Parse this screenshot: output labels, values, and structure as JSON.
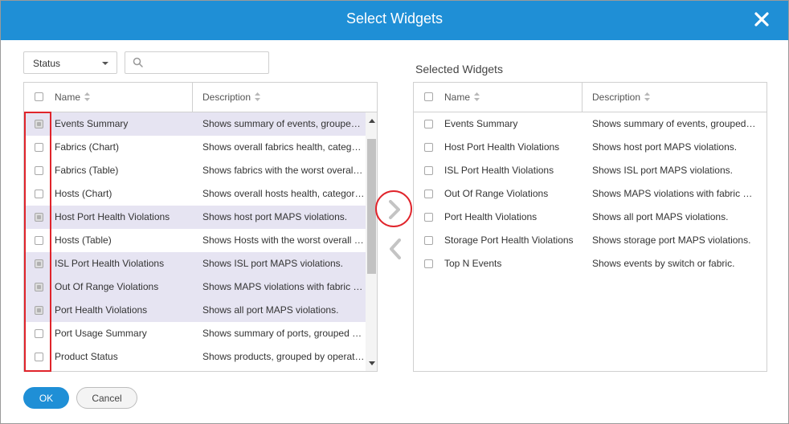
{
  "dialog": {
    "title": "Select Widgets",
    "close_icon": "close-icon"
  },
  "filter": {
    "selected": "Status",
    "search_value": "",
    "search_placeholder": ""
  },
  "available": {
    "columns": {
      "name": "Name",
      "description": "Description"
    },
    "rows": [
      {
        "name": "Events Summary",
        "description": "Shows summary of events, grouped by severity.",
        "checked": true
      },
      {
        "name": "Fabrics (Chart)",
        "description": "Shows overall fabrics health, categorized by status.",
        "checked": false
      },
      {
        "name": "Fabrics (Table)",
        "description": "Shows fabrics with the worst overall health.",
        "checked": false
      },
      {
        "name": "Hosts (Chart)",
        "description": "Shows overall hosts health, categorized by status.",
        "checked": false
      },
      {
        "name": "Host Port Health Violations",
        "description": "Shows host port MAPS violations.",
        "checked": true
      },
      {
        "name": "Hosts (Table)",
        "description": "Shows Hosts with the worst overall health.",
        "checked": false
      },
      {
        "name": "ISL Port Health Violations",
        "description": "Shows ISL port MAPS violations.",
        "checked": true
      },
      {
        "name": "Out Of Range Violations",
        "description": "Shows MAPS violations with fabric performance impact.",
        "checked": true
      },
      {
        "name": "Port Health Violations",
        "description": "Shows all port MAPS violations.",
        "checked": true
      },
      {
        "name": "Port Usage Summary",
        "description": "Shows summary of ports, grouped by usage.",
        "checked": false
      },
      {
        "name": "Product Status",
        "description": "Shows products, grouped by operational status.",
        "checked": false
      }
    ]
  },
  "selected_widgets": {
    "label": "Selected Widgets",
    "columns": {
      "name": "Name",
      "description": "Description"
    },
    "rows": [
      {
        "name": "Events Summary",
        "description": "Shows summary of events, grouped by severity."
      },
      {
        "name": "Host Port Health Violations",
        "description": "Shows host port MAPS violations."
      },
      {
        "name": "ISL Port Health Violations",
        "description": "Shows ISL port MAPS violations."
      },
      {
        "name": "Out Of Range Violations",
        "description": "Shows MAPS violations with fabric performance impact."
      },
      {
        "name": "Port Health Violations",
        "description": "Shows all port MAPS violations."
      },
      {
        "name": "Storage Port Health Violations",
        "description": "Shows storage port MAPS violations."
      },
      {
        "name": "Top N Events",
        "description": "Shows events by switch or fabric."
      }
    ]
  },
  "buttons": {
    "ok": "OK",
    "cancel": "Cancel"
  },
  "colors": {
    "accent": "#1f8fd6",
    "highlight": "#e0242b",
    "row_selected": "#e6e4f2"
  }
}
